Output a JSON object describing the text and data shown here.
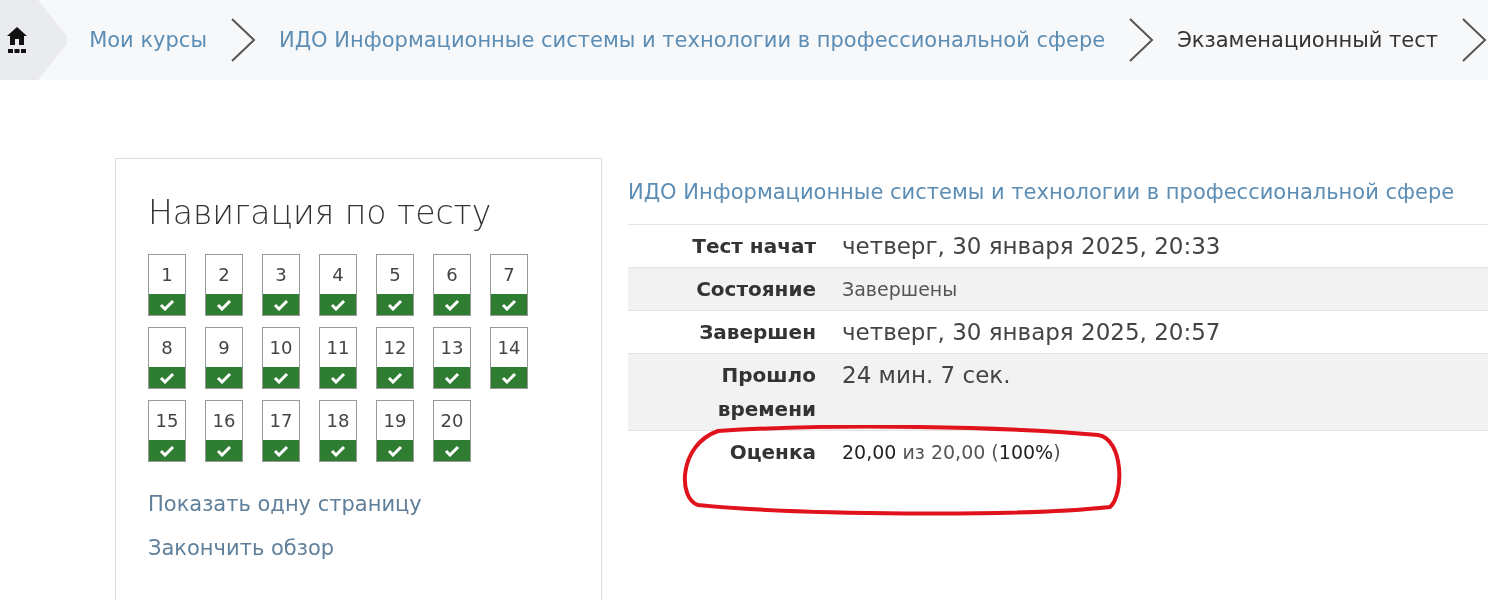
{
  "breadcrumb": {
    "items": [
      {
        "label": "Мои курсы",
        "kind": "link"
      },
      {
        "label": "ИДО Информационные системы и технологии в профессиональной сфере",
        "kind": "link"
      },
      {
        "label": "Экзаменационный тест",
        "kind": "current"
      }
    ]
  },
  "quiz_navigation": {
    "title": "Навигация по тесту",
    "questions": [
      {
        "number": "1",
        "answered": true
      },
      {
        "number": "2",
        "answered": true
      },
      {
        "number": "3",
        "answered": true
      },
      {
        "number": "4",
        "answered": true
      },
      {
        "number": "5",
        "answered": true
      },
      {
        "number": "6",
        "answered": true
      },
      {
        "number": "7",
        "answered": true
      },
      {
        "number": "8",
        "answered": true
      },
      {
        "number": "9",
        "answered": true
      },
      {
        "number": "10",
        "answered": true
      },
      {
        "number": "11",
        "answered": true
      },
      {
        "number": "12",
        "answered": true
      },
      {
        "number": "13",
        "answered": true
      },
      {
        "number": "14",
        "answered": true
      },
      {
        "number": "15",
        "answered": true
      },
      {
        "number": "16",
        "answered": true
      },
      {
        "number": "17",
        "answered": true
      },
      {
        "number": "18",
        "answered": true
      },
      {
        "number": "19",
        "answered": true
      },
      {
        "number": "20",
        "answered": true
      }
    ],
    "links": [
      "Показать одну страницу",
      "Закончить обзор"
    ]
  },
  "summary": {
    "course_link": "ИДО Информационные системы и технологии в профессиональной сфере",
    "rows": [
      {
        "label": "Тест начат",
        "value": "четверг, 30 января 2025, 20:33",
        "kind": "timestamp"
      },
      {
        "label": "Состояние",
        "value": "Завершены",
        "kind": "plain"
      },
      {
        "label": "Завершен",
        "value": "четверг, 30 января 2025, 20:57",
        "kind": "timestamp"
      },
      {
        "label": "Прошло времени",
        "value": "24 мин. 7 сек.",
        "kind": "timestamp"
      },
      {
        "label": "Оценка",
        "value": "**20,00** из 20,00 (**100%**)",
        "kind": "plain"
      }
    ]
  }
}
